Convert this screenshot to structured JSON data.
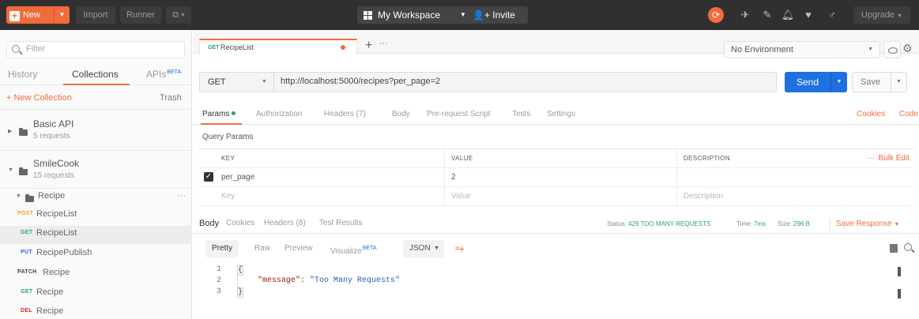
{
  "topbar": {
    "new_label": "New",
    "import_label": "Import",
    "runner_label": "Runner",
    "workspace_label": "My Workspace",
    "invite_label": "Invite",
    "upgrade_label": "Upgrade"
  },
  "sidebar": {
    "filter_placeholder": "Filter",
    "tabs": [
      "History",
      "Collections",
      "APIs"
    ],
    "beta_label": "BETA",
    "new_collection": "+ New Collection",
    "trash": "Trash",
    "collections": [
      {
        "name": "Basic API",
        "count": "5 requests"
      },
      {
        "name": "SmileCook",
        "count": "15 requests"
      }
    ],
    "folder": {
      "name": "Recipe",
      "more": "···"
    },
    "requests": [
      {
        "method": "POST",
        "name": "RecipeList"
      },
      {
        "method": "GET",
        "name": "RecipeList"
      },
      {
        "method": "PUT",
        "name": "RecipePublish"
      },
      {
        "method": "PATCH",
        "name": "Recipe"
      },
      {
        "method": "GET",
        "name": "Recipe"
      },
      {
        "method": "DEL",
        "name": "Recipe"
      }
    ]
  },
  "tab": {
    "method": "GET",
    "title": "RecipeList",
    "more": "···"
  },
  "environment": {
    "selected": "No Environment"
  },
  "request": {
    "method": "GET",
    "url": "http://localhost:5000/recipes?per_page=2",
    "send_label": "Send",
    "save_label": "Save"
  },
  "request_tabs": [
    "Params",
    "Authorization",
    "Headers (7)",
    "Body",
    "Pre-request Script",
    "Tests",
    "Settings"
  ],
  "cookies_label": "Cookies",
  "code_label": "Code",
  "params": {
    "title": "Query Params",
    "headers": [
      "KEY",
      "VALUE",
      "DESCRIPTION"
    ],
    "rows": [
      {
        "key": "per_page",
        "value": "2",
        "description": ""
      }
    ],
    "placeholder": {
      "key": "Key",
      "value": "Value",
      "description": "Description"
    },
    "more": "···",
    "bulk_edit": "Bulk Edit"
  },
  "response": {
    "tabs": [
      "Body",
      "Cookies",
      "Headers (8)",
      "Test Results"
    ],
    "status_label": "Status:",
    "status_value": "429 TOO MANY REQUESTS",
    "time_label": "Time:",
    "time_value": "7ms",
    "size_label": "Size:",
    "size_value": "296 B",
    "save_response": "Save Response",
    "views": [
      "Pretty",
      "Raw",
      "Preview",
      "Visualize"
    ],
    "format": "JSON",
    "lines": [
      "1",
      "2",
      "3"
    ],
    "body_open": "{",
    "body_key": "\"message\"",
    "body_sep": ": ",
    "body_value": "\"Too Many Requests\"",
    "body_close": "}"
  },
  "colors": {
    "accent": "#f26b3a",
    "send": "#1f70e0",
    "get": "#2ea463",
    "post": "#f5a623",
    "put": "#2a66d4",
    "delete": "#d0262d"
  }
}
